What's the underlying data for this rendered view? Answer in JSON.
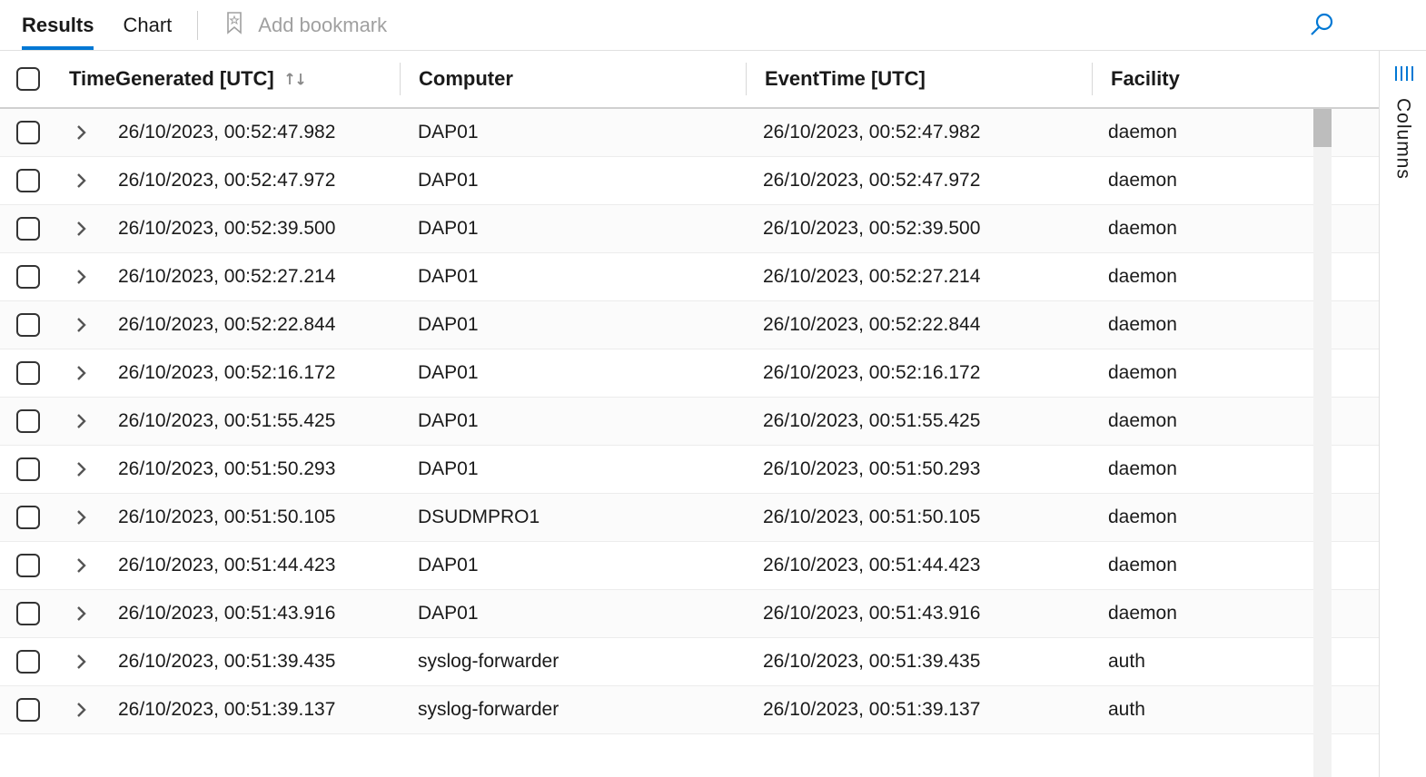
{
  "toolbar": {
    "tabs": [
      {
        "label": "Results",
        "active": true
      },
      {
        "label": "Chart",
        "active": false
      }
    ],
    "bookmark_label": "Add bookmark"
  },
  "columns": {
    "time_generated": "TimeGenerated [UTC]",
    "computer": "Computer",
    "event_time": "EventTime [UTC]",
    "facility": "Facility"
  },
  "side_panel": {
    "label": "Columns"
  },
  "rows": [
    {
      "time": "26/10/2023, 00:52:47.982",
      "computer": "DAP01",
      "event_time": "26/10/2023, 00:52:47.982",
      "facility": "daemon"
    },
    {
      "time": "26/10/2023, 00:52:47.972",
      "computer": "DAP01",
      "event_time": "26/10/2023, 00:52:47.972",
      "facility": "daemon"
    },
    {
      "time": "26/10/2023, 00:52:39.500",
      "computer": "DAP01",
      "event_time": "26/10/2023, 00:52:39.500",
      "facility": "daemon"
    },
    {
      "time": "26/10/2023, 00:52:27.214",
      "computer": "DAP01",
      "event_time": "26/10/2023, 00:52:27.214",
      "facility": "daemon"
    },
    {
      "time": "26/10/2023, 00:52:22.844",
      "computer": "DAP01",
      "event_time": "26/10/2023, 00:52:22.844",
      "facility": "daemon"
    },
    {
      "time": "26/10/2023, 00:52:16.172",
      "computer": "DAP01",
      "event_time": "26/10/2023, 00:52:16.172",
      "facility": "daemon"
    },
    {
      "time": "26/10/2023, 00:51:55.425",
      "computer": "DAP01",
      "event_time": "26/10/2023, 00:51:55.425",
      "facility": "daemon"
    },
    {
      "time": "26/10/2023, 00:51:50.293",
      "computer": "DAP01",
      "event_time": "26/10/2023, 00:51:50.293",
      "facility": "daemon"
    },
    {
      "time": "26/10/2023, 00:51:50.105",
      "computer": "DSUDMPRO1",
      "event_time": "26/10/2023, 00:51:50.105",
      "facility": "daemon"
    },
    {
      "time": "26/10/2023, 00:51:44.423",
      "computer": "DAP01",
      "event_time": "26/10/2023, 00:51:44.423",
      "facility": "daemon"
    },
    {
      "time": "26/10/2023, 00:51:43.916",
      "computer": "DAP01",
      "event_time": "26/10/2023, 00:51:43.916",
      "facility": "daemon"
    },
    {
      "time": "26/10/2023, 00:51:39.435",
      "computer": "syslog-forwarder",
      "event_time": "26/10/2023, 00:51:39.435",
      "facility": "auth"
    },
    {
      "time": "26/10/2023, 00:51:39.137",
      "computer": "syslog-forwarder",
      "event_time": "26/10/2023, 00:51:39.137",
      "facility": "auth"
    }
  ]
}
